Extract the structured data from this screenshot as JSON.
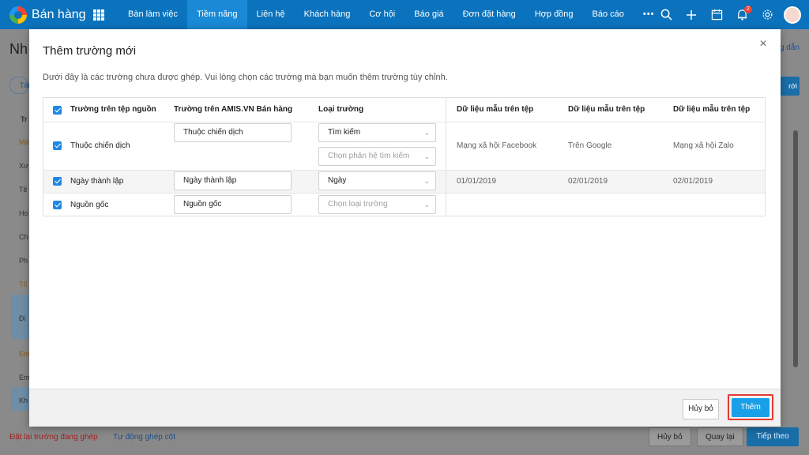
{
  "app": {
    "title": "Bán hàng"
  },
  "nav": [
    "Bàn làm việc",
    "Tiềm năng",
    "Liên hệ",
    "Khách hàng",
    "Cơ hội",
    "Báo giá",
    "Đơn đặt hàng",
    "Hợp đồng",
    "Báo cáo",
    "•••"
  ],
  "nav_active_index": 1,
  "notifications_count": "2",
  "background": {
    "title": "Nh",
    "help_link": "g dẫn",
    "filter_chip": "Tất",
    "right_button": "rới",
    "rows": [
      "Tr",
      "Mã",
      "Xư",
      "Tê",
      "Họ",
      "Ch",
      "Ph",
      "Tổ",
      "Đi",
      "Em",
      "Em",
      "Kh"
    ],
    "footer": {
      "reset": "Đặt lại trường đang ghép",
      "auto": "Tự động ghép cột",
      "cancel": "Hủy bỏ",
      "back": "Quay lại",
      "next": "Tiếp theo"
    }
  },
  "modal": {
    "title": "Thêm trường mới",
    "close": "×",
    "description": "Dưới đây là các trường chưa được ghép. Vui lòng chọn các trường mà bạn muốn thêm trường tùy chỉnh.",
    "headers": {
      "source": "Trường trên tệp nguồn",
      "amis": "Trường trên AMIS.VN Bán hàng",
      "type": "Loại trường",
      "sample1": "Dữ liệu mẫu trên tệp",
      "sample2": "Dữ liệu mẫu trên tệp",
      "sample3": "Dữ liệu mẫu trên tệp"
    },
    "rows": [
      {
        "source": "Thuộc chiến dịch",
        "amis": "Thuộc chiến dịch",
        "type": "Tìm kiếm",
        "type_extra": "Chọn phân hệ tìm kiếm",
        "samples": [
          "Mạng xã hội Facebook",
          "Trên Google",
          "Mạng xã hội Zalo"
        ]
      },
      {
        "source": "Ngày thành lập",
        "amis": "Ngày thành lập",
        "type": "Ngày",
        "samples": [
          "01/01/2019",
          "02/01/2019",
          "02/01/2019"
        ]
      },
      {
        "source": "Nguồn gốc",
        "amis": "Nguồn gốc",
        "type": "Chọn loại trường",
        "samples": [
          "",
          "",
          ""
        ]
      }
    ],
    "buttons": {
      "cancel": "Hủy bỏ",
      "add": "Thêm"
    }
  },
  "colors": {
    "topbar": "#0b73bd",
    "accent": "#1aa0e8",
    "highlight": "#e53935"
  },
  "icons": [
    "search-icon",
    "plus-icon",
    "calendar-icon",
    "bell-icon",
    "gear-icon",
    "avatar",
    "checkbox-checked-icon",
    "chevron-down-icon",
    "close-icon"
  ]
}
